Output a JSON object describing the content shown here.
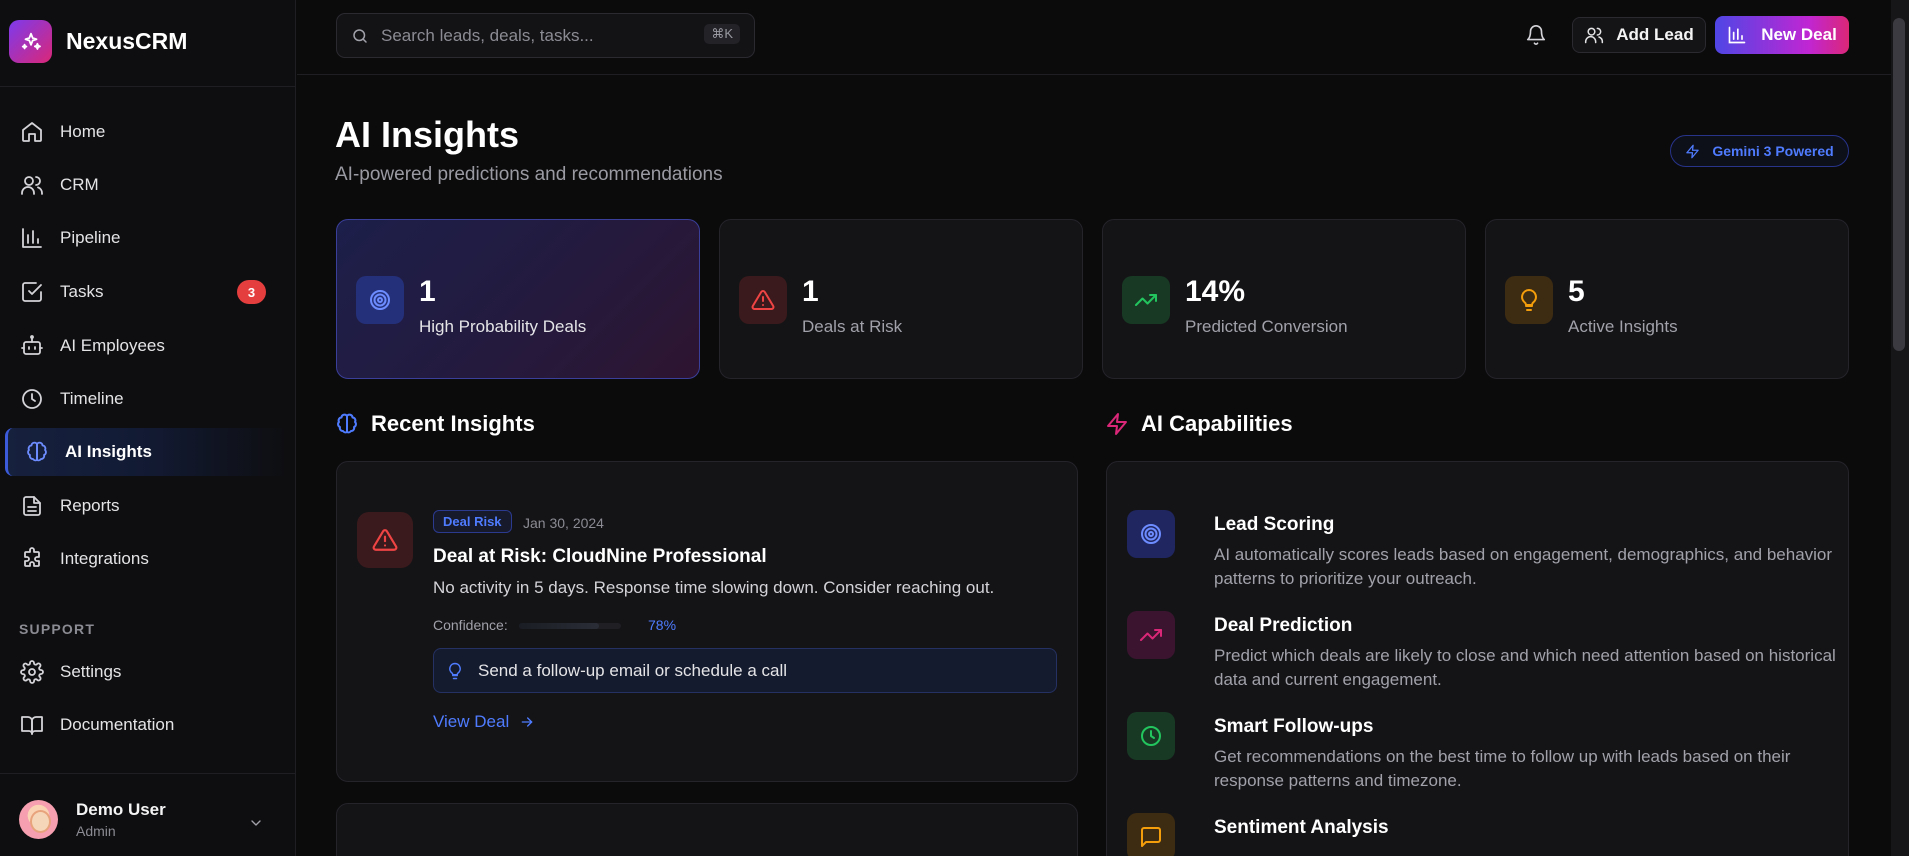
{
  "brand": {
    "name": "NexusCRM"
  },
  "nav": {
    "items": [
      {
        "label": "Home",
        "icon": "home-icon"
      },
      {
        "label": "CRM",
        "icon": "users-icon"
      },
      {
        "label": "Pipeline",
        "icon": "bar-chart-icon"
      },
      {
        "label": "Tasks",
        "icon": "check-square-icon",
        "badge": "3"
      },
      {
        "label": "AI Employees",
        "icon": "bot-icon"
      },
      {
        "label": "Timeline",
        "icon": "clock-icon"
      },
      {
        "label": "AI Insights",
        "icon": "brain-icon",
        "active": true
      },
      {
        "label": "Reports",
        "icon": "file-text-icon"
      },
      {
        "label": "Integrations",
        "icon": "puzzle-icon"
      }
    ],
    "support_label": "SUPPORT",
    "support_items": [
      {
        "label": "Settings",
        "icon": "gear-icon"
      },
      {
        "label": "Documentation",
        "icon": "book-icon"
      }
    ]
  },
  "user": {
    "name": "Demo User",
    "role": "Admin"
  },
  "topbar": {
    "search_placeholder": "Search leads, deals, tasks...",
    "search_shortcut": "⌘K",
    "add_lead_label": "Add Lead",
    "new_deal_label": "New Deal"
  },
  "page": {
    "title": "AI Insights",
    "subtitle": "AI-powered predictions and recommendations",
    "badge": "Gemini 3 Powered"
  },
  "stats": [
    {
      "value": "1",
      "label": "High Probability Deals",
      "icon": "target-icon",
      "color": "#4f7cff"
    },
    {
      "value": "1",
      "label": "Deals at Risk",
      "icon": "alert-triangle-icon",
      "color": "#ef4444"
    },
    {
      "value": "14%",
      "label": "Predicted Conversion",
      "icon": "trending-up-icon",
      "color": "#22c55e"
    },
    {
      "value": "5",
      "label": "Active Insights",
      "icon": "lightbulb-icon",
      "color": "#f59e0b"
    }
  ],
  "recent_insights": {
    "title": "Recent Insights",
    "items": [
      {
        "tag": "Deal Risk",
        "date": "Jan 30, 2024",
        "title": "Deal at Risk: CloudNine Professional",
        "description": "No activity in 5 days. Response time slowing down. Consider reaching out.",
        "confidence_label": "Confidence:",
        "confidence": 0.78,
        "confidence_text": "78%",
        "recommendation": "Send a follow-up email or schedule a call",
        "action": "View Deal"
      }
    ]
  },
  "capabilities": {
    "title": "AI Capabilities",
    "items": [
      {
        "title": "Lead Scoring",
        "description": "AI automatically scores leads based on engagement, demographics, and behavior patterns to prioritize your outreach.",
        "icon": "target-icon",
        "color": "#4f7cff"
      },
      {
        "title": "Deal Prediction",
        "description": "Predict which deals are likely to close and which need attention based on historical data and current engagement.",
        "icon": "trending-up-icon",
        "color": "#db2777"
      },
      {
        "title": "Smart Follow-ups",
        "description": "Get recommendations on the best time to follow up with leads based on their response patterns and timezone.",
        "icon": "clock-icon",
        "color": "#22c55e"
      },
      {
        "title": "Sentiment Analysis",
        "description": "",
        "icon": "message-square-icon",
        "color": "#f59e0b"
      }
    ]
  }
}
